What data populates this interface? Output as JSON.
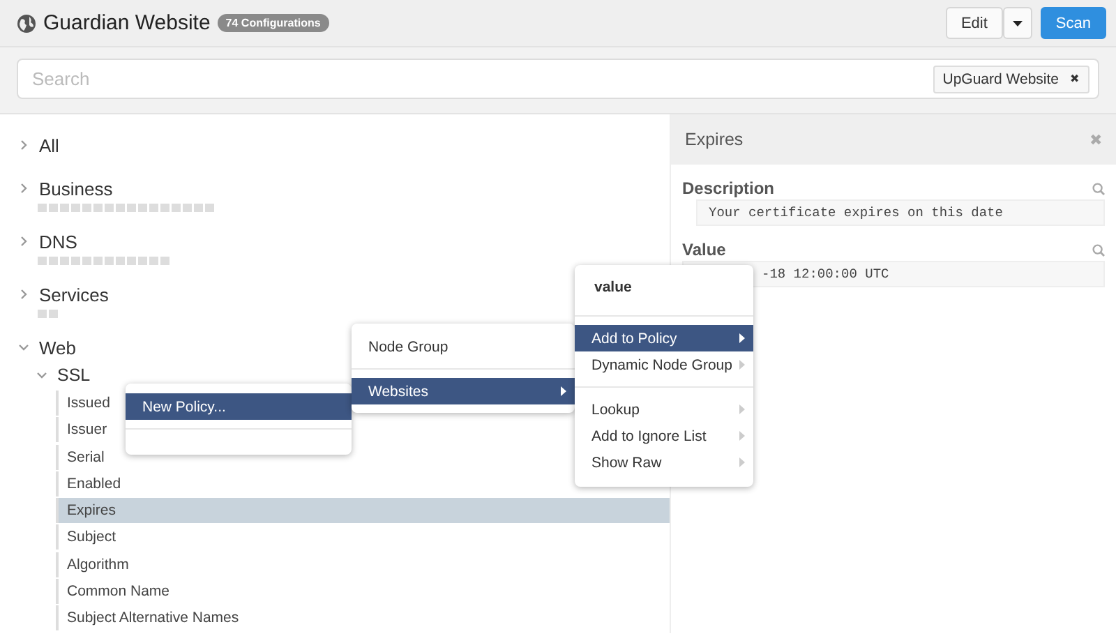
{
  "header": {
    "title": "Guardian Website",
    "badge": "74 Configurations",
    "buttons": [
      {
        "label": "Edit",
        "kind": "default"
      },
      {
        "kind": "caret"
      },
      {
        "label": "Scan",
        "kind": "primary"
      }
    ]
  },
  "search": {
    "placeholder": "Search",
    "tags": [
      {
        "label": "UpGuard Website",
        "remove": "✖"
      }
    ]
  },
  "tree": [
    {
      "label": "All",
      "expanded": false,
      "kind": "plain"
    },
    {
      "label": "Business",
      "expanded": false,
      "kind": "long"
    },
    {
      "label": "DNS",
      "expanded": false,
      "kind": "medium"
    },
    {
      "label": "Services",
      "expanded": false,
      "kind": "short"
    },
    {
      "label": "Web",
      "expanded": true,
      "children": [
        {
          "label": "SSL",
          "expanded": true,
          "children": [
            {
              "label": "Issued",
              "selected": false
            },
            {
              "label": "Issuer",
              "selected": false
            },
            {
              "label": "Serial",
              "selected": false
            },
            {
              "label": "Enabled",
              "selected": false
            },
            {
              "label": "Expires",
              "selected": true
            },
            {
              "label": "Subject",
              "selected": false
            },
            {
              "label": "Algorithm",
              "selected": false
            },
            {
              "label": "Common Name",
              "selected": false
            },
            {
              "label": "Subject Alternative Names",
              "selected": false
            }
          ]
        }
      ]
    }
  ],
  "detail": {
    "title": "Expires",
    "close": "✖",
    "fields": [
      {
        "label": "Description",
        "value": "Your certificate expires on this date",
        "kind": "description"
      },
      {
        "label": "Value",
        "value": "-18 12:00:00 UTC",
        "kind": "value"
      }
    ]
  },
  "menus": [
    {
      "items": [
        {
          "kind": "item",
          "label": "New Policy...",
          "selected": true,
          "submenu": false
        },
        {
          "kind": "divider"
        }
      ]
    },
    {
      "items": [
        {
          "kind": "item",
          "label": "Node Group",
          "selected": false,
          "submenu": false
        },
        {
          "kind": "divider"
        },
        {
          "kind": "item",
          "label": "Websites",
          "selected": true,
          "submenu": true
        }
      ]
    },
    {
      "items": [
        {
          "kind": "header",
          "label": "value"
        },
        {
          "kind": "divider"
        },
        {
          "kind": "item",
          "label": "Add to Policy",
          "selected": true,
          "submenu": true
        },
        {
          "kind": "item",
          "label": "Dynamic Node Group",
          "selected": false,
          "submenu": true
        },
        {
          "kind": "divider"
        },
        {
          "kind": "item",
          "label": "Lookup",
          "selected": false,
          "submenu": true
        },
        {
          "kind": "item",
          "label": "Add to Ignore List",
          "selected": false,
          "submenu": true
        },
        {
          "kind": "item",
          "label": "Show Raw",
          "selected": false,
          "submenu": true
        }
      ]
    }
  ]
}
